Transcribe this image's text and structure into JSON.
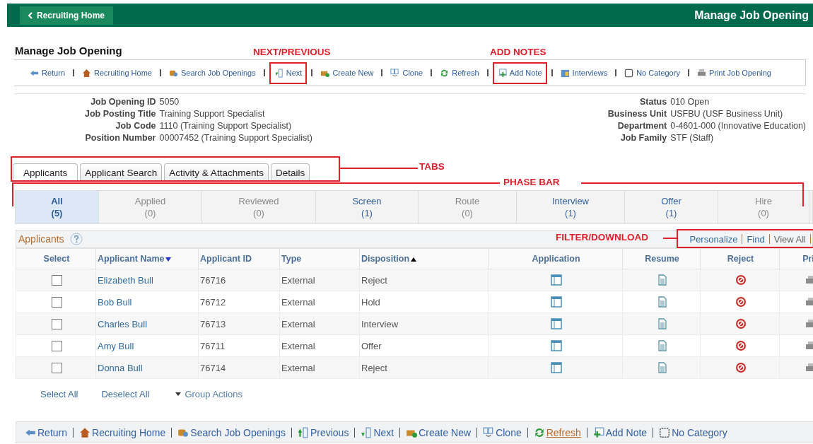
{
  "header": {
    "back_button": "Recruiting Home",
    "title": "Manage Job Opening"
  },
  "page_title": "Manage Job Opening",
  "annotations": {
    "next_previous": "NEXT/PREVIOUS",
    "add_notes": "ADD NOTES",
    "tabs": "TABS",
    "phase_bar": "PHASE BAR",
    "filter_download": "FILTER/DOWNLOAD"
  },
  "toolbar": [
    {
      "label": "Return",
      "kind": "return",
      "highlighted": false
    },
    {
      "label": "Recruiting Home",
      "kind": "home",
      "highlighted": false
    },
    {
      "label": "Search Job Openings",
      "kind": "search",
      "highlighted": false
    },
    {
      "label": "Next",
      "kind": "next",
      "highlighted": true
    },
    {
      "label": "Create New",
      "kind": "create",
      "highlighted": false
    },
    {
      "label": "Clone",
      "kind": "clone",
      "highlighted": false
    },
    {
      "label": "Refresh",
      "kind": "refresh",
      "highlighted": false
    },
    {
      "label": "Add Note",
      "kind": "note",
      "highlighted": true
    },
    {
      "label": "Interviews",
      "kind": "interviews",
      "highlighted": false
    },
    {
      "label": "No Category",
      "kind": "category",
      "highlighted": false
    },
    {
      "label": "Print Job Opening",
      "kind": "print",
      "highlighted": false
    }
  ],
  "info_left": [
    {
      "label": "Job Opening ID",
      "value": "5050"
    },
    {
      "label": "Job Posting Title",
      "value": "Training Support Specialist"
    },
    {
      "label": "Job Code",
      "value": "1110 (Training Support Specialist)"
    },
    {
      "label": "Position Number",
      "value": "00007452 (Training Support Specialist)"
    }
  ],
  "info_right": [
    {
      "label": "Status",
      "value": "010 Open"
    },
    {
      "label": "Business Unit",
      "value": "USFBU (USF Business Unit)"
    },
    {
      "label": "Department",
      "value": "0-4601-000 (Innovative Education)"
    },
    {
      "label": "Job Family",
      "value": "STF (Staff)"
    }
  ],
  "tabs": [
    {
      "label": "Applicants",
      "selected": true
    },
    {
      "label": "Applicant Search",
      "selected": false
    },
    {
      "label": "Activity & Attachments",
      "selected": false
    },
    {
      "label": "Details",
      "selected": false
    }
  ],
  "phases": [
    {
      "label": "All",
      "count": "(5)",
      "selected": true,
      "disabled": false
    },
    {
      "label": "Applied",
      "count": "(0)",
      "selected": false,
      "disabled": true
    },
    {
      "label": "Reviewed",
      "count": "(0)",
      "selected": false,
      "disabled": true
    },
    {
      "label": "Screen",
      "count": "(1)",
      "selected": false,
      "disabled": false
    },
    {
      "label": "Route",
      "count": "(0)",
      "selected": false,
      "disabled": true
    },
    {
      "label": "Interview",
      "count": "(1)",
      "selected": false,
      "disabled": false
    },
    {
      "label": "Offer",
      "count": "(1)",
      "selected": false,
      "disabled": false
    },
    {
      "label": "Hire",
      "count": "(0)",
      "selected": false,
      "disabled": true
    }
  ],
  "grid": {
    "title": "Applicants",
    "links": [
      "Personalize",
      "Find",
      "View All"
    ],
    "columns": [
      {
        "label": "Select",
        "kind": "plain"
      },
      {
        "label": "Applicant Name",
        "kind": "sorted_desc"
      },
      {
        "label": "Applicant ID",
        "kind": "plain"
      },
      {
        "label": "Type",
        "kind": "plain"
      },
      {
        "label": "Disposition",
        "kind": "sorted_asc"
      },
      {
        "label": "Application",
        "kind": "plain"
      },
      {
        "label": "Resume",
        "kind": "plain"
      },
      {
        "label": "Reject",
        "kind": "plain"
      },
      {
        "label": "Pri",
        "kind": "plain"
      }
    ],
    "rows": [
      {
        "checked": false,
        "name": "Elizabeth Bull",
        "id": "76716",
        "type": "External",
        "disposition": "Reject"
      },
      {
        "checked": false,
        "name": "Bob Bull",
        "id": "76712",
        "type": "External",
        "disposition": "Hold"
      },
      {
        "checked": false,
        "name": "Charles Bull",
        "id": "76713",
        "type": "External",
        "disposition": "Interview"
      },
      {
        "checked": false,
        "name": "Amy Bull",
        "id": "76711",
        "type": "External",
        "disposition": "Offer"
      },
      {
        "checked": false,
        "name": "Donna Bull",
        "id": "76714",
        "type": "External",
        "disposition": "Reject"
      }
    ]
  },
  "grid_actions": [
    "Select All",
    "Deselect All",
    "Group Actions"
  ],
  "bottom_toolbar": [
    {
      "label": "Return",
      "kind": "return",
      "underlined": false
    },
    {
      "label": "Recruiting Home",
      "kind": "home",
      "underlined": false
    },
    {
      "label": "Search Job Openings",
      "kind": "search",
      "underlined": false
    },
    {
      "label": "Previous",
      "kind": "previous",
      "underlined": false
    },
    {
      "label": "Next",
      "kind": "next",
      "underlined": false
    },
    {
      "label": "Create New",
      "kind": "create",
      "underlined": false
    },
    {
      "label": "Clone",
      "kind": "clone",
      "underlined": false
    },
    {
      "label": "Refresh",
      "kind": "refresh",
      "underlined": true
    },
    {
      "label": "Add Note",
      "kind": "note",
      "underlined": false
    },
    {
      "label": "No Category",
      "kind": "category",
      "underlined": false
    }
  ]
}
